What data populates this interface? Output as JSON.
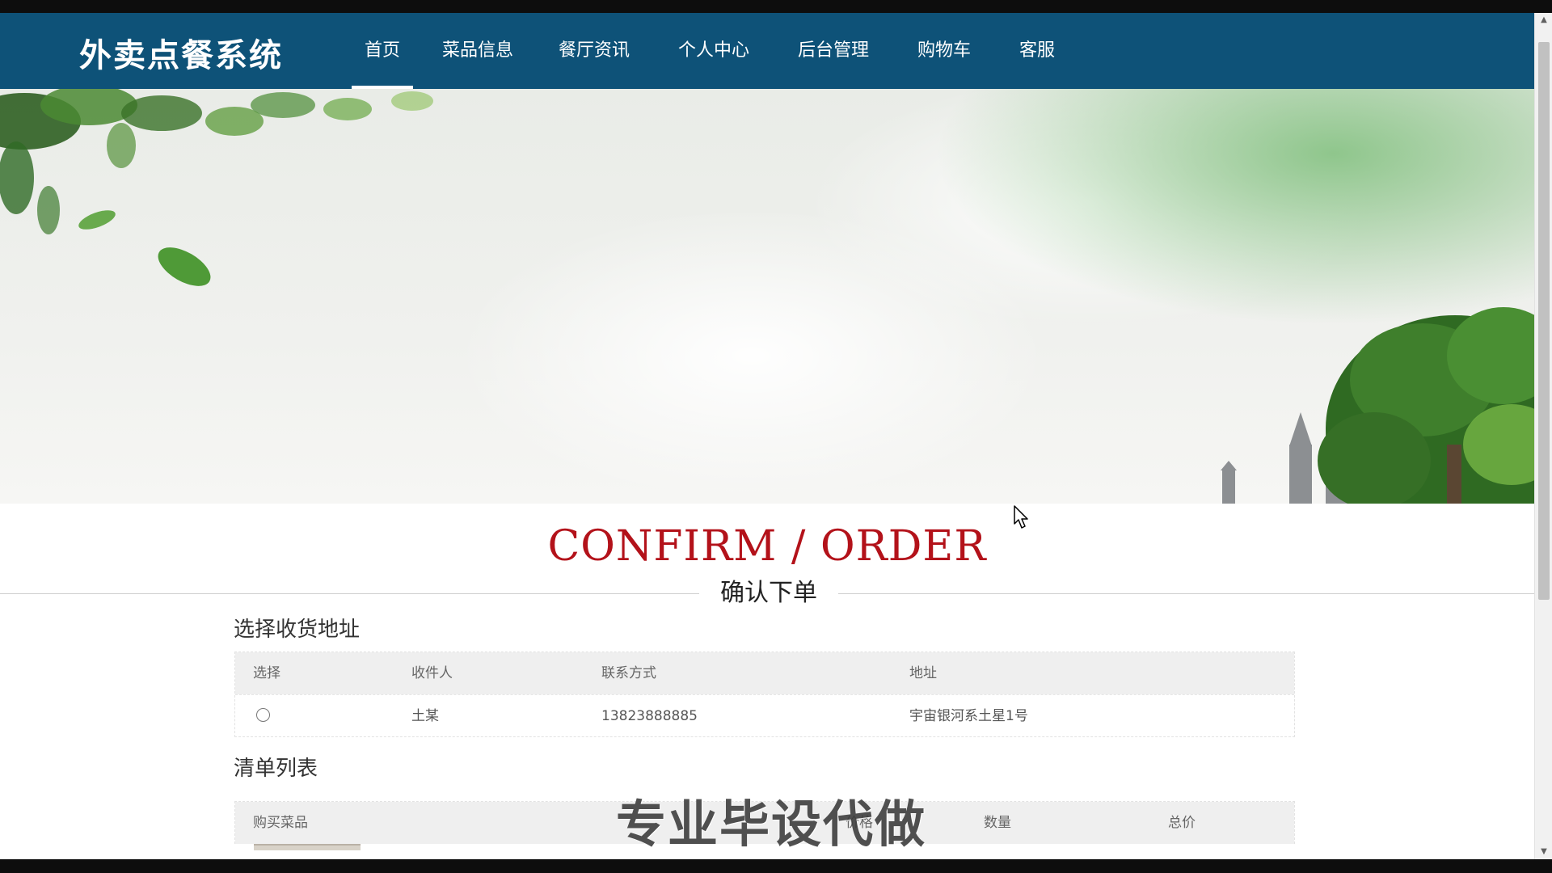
{
  "header": {
    "brand": "外卖点餐系统",
    "nav": [
      {
        "label": "首页",
        "active": true
      },
      {
        "label": "菜品信息"
      },
      {
        "label": "餐厅资讯"
      },
      {
        "label": "个人中心"
      },
      {
        "label": "后台管理"
      },
      {
        "label": "购物车"
      },
      {
        "label": "客服"
      }
    ]
  },
  "page": {
    "heading_en": "CONFIRM / ORDER",
    "heading_cn": "确认下单"
  },
  "address_section": {
    "title": "选择收货地址",
    "columns": [
      "选择",
      "收件人",
      "联系方式",
      "地址"
    ],
    "rows": [
      {
        "selected": false,
        "recipient": "土某",
        "phone": "13823888885",
        "address": "宇宙银河系土星1号"
      }
    ]
  },
  "list_section": {
    "title": "清单列表",
    "columns": [
      "购买菜品",
      "价格",
      "数量",
      "总价"
    ]
  },
  "watermark": "专业毕设代做",
  "colors": {
    "header_bg": "#0e5278",
    "heading_en": "#b3121a",
    "table_header_bg": "#efefef"
  }
}
